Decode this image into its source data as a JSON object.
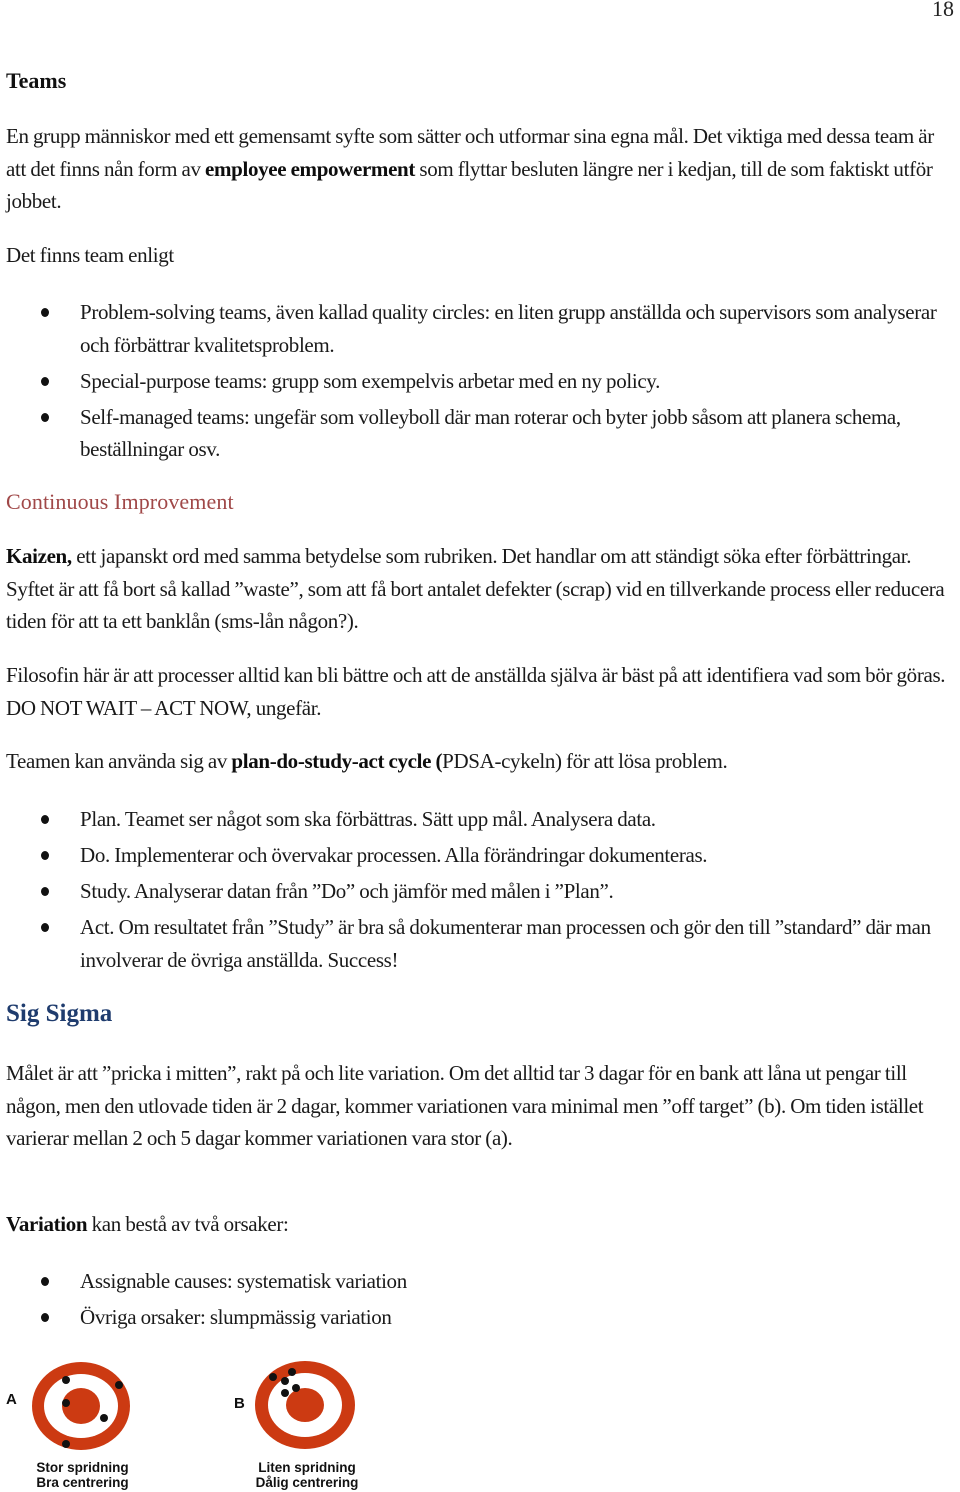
{
  "page_number": "18",
  "teams": {
    "heading": "Teams",
    "intro_part1": "En grupp människor med ett gemensamt syfte som sätter och utformar sina egna mål. Det viktiga med dessa team är att det finns nån form av ",
    "intro_bold": "employee empowerment",
    "intro_part2": " som flyttar besluten längre ner i kedjan, till de som faktiskt utför jobbet.",
    "list_intro": "Det finns team enligt",
    "types": [
      "Problem-solving teams, även kallad quality circles: en liten grupp anställda och supervisors som analyserar och förbättrar kvalitetsproblem.",
      "Special-purpose teams: grupp som exempelvis arbetar med en ny policy.",
      "Self-managed teams: ungefär som volleyboll där man roterar och byter jobb såsom att planera schema, beställningar osv."
    ]
  },
  "continuous_improvement": {
    "heading": "Continuous Improvement",
    "kaizen_bold": "Kaizen,",
    "kaizen_text": " ett japanskt ord med samma betydelse som rubriken. Det handlar om att ständigt söka efter förbättringar. Syftet är att få bort så kallad ”waste”, som att få bort antalet defekter (scrap) vid en tillverkande process eller reducera tiden för att ta ett banklån (sms-lån någon?).",
    "philosophy": "Filosofin här är att processer alltid kan bli bättre och att de anställda själva är bäst på att identifiera vad som bör göras. DO NOT WAIT – ACT NOW, ungefär.",
    "pdsa_part1": "Teamen kan använda sig av ",
    "pdsa_bold": "plan-do-study-act cycle (",
    "pdsa_part2": "PDSA-cykeln) för att lösa problem.",
    "pdsa_steps": [
      "Plan. Teamet ser något som ska förbättras. Sätt upp mål. Analysera data.",
      "Do. Implementerar och övervakar processen. Alla förändringar dokumenteras.",
      "Study. Analyserar datan från ”Do” och jämför med målen i ”Plan”.",
      "Act. Om resultatet från ”Study” är bra så dokumenterar man processen och gör den till ”standard” där man involverar de övriga anställda. Success!"
    ]
  },
  "six_sigma": {
    "heading": "Sig Sigma",
    "paragraph": "Målet är att ”pricka i mitten”, rakt på och lite variation. Om det alltid tar 3 dagar för en bank att låna ut pengar till någon, men den utlovade tiden är 2 dagar, kommer variationen vara minimal men ”off target” (b). Om tiden istället varierar mellan 2 och 5 dagar kommer variationen vara stor (a).",
    "variation_bold": "Variation",
    "variation_text": " kan bestå av två orsaker:",
    "causes": [
      "Assignable causes: systematisk variation",
      "Övriga orsaker: slumpmässig variation"
    ]
  },
  "figures": [
    {
      "letter": "A",
      "caption_line1": "Stor spridning",
      "caption_line2": "Bra centrering"
    },
    {
      "letter": "B",
      "caption_line1": "Liten spridning",
      "caption_line2": "Dålig centrering"
    }
  ],
  "colors": {
    "heading_red": "#a04848",
    "heading_blue": "#1f3c6e",
    "target_red": "#cc3a12",
    "shot_black": "#111111"
  }
}
